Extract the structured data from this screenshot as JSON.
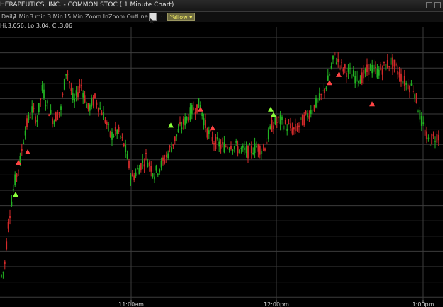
{
  "window": {
    "title": "HERAPEUTICS, INC. - COMMON STOC ( 1 Minute Chart)"
  },
  "toolbar": {
    "items": [
      "Daily",
      "1 Min",
      "3 min",
      "3 Min",
      "15 Min",
      "Zoom In",
      "Zoom Out",
      "Line"
    ],
    "color_selected": "Yellow",
    "icon": "cursor-icon"
  },
  "readout": "Hi:3.056, Lo:3.04, Cl:3.06",
  "colors": {
    "background": "#000000",
    "grid": "#3c3c3c",
    "up": "#22b422",
    "down": "#d42a2a",
    "buy_marker": "#8cff3a",
    "sell_marker": "#ff4444"
  },
  "chart_data": {
    "type": "candlestick",
    "x_tick_labels": [
      "11:00am",
      "12:00pm",
      "1:00pm"
    ],
    "price_path_points": [
      [
        0,
        0.06
      ],
      [
        6,
        0.1
      ],
      [
        12,
        0.28
      ],
      [
        20,
        0.42
      ],
      [
        28,
        0.5
      ],
      [
        35,
        0.62
      ],
      [
        45,
        0.7
      ],
      [
        52,
        0.66
      ],
      [
        60,
        0.78
      ],
      [
        66,
        0.72
      ],
      [
        75,
        0.66
      ],
      [
        86,
        0.7
      ],
      [
        94,
        0.86
      ],
      [
        104,
        0.72
      ],
      [
        114,
        0.8
      ],
      [
        124,
        0.7
      ],
      [
        134,
        0.74
      ],
      [
        146,
        0.68
      ],
      [
        156,
        0.6
      ],
      [
        166,
        0.62
      ],
      [
        176,
        0.56
      ],
      [
        186,
        0.44
      ],
      [
        196,
        0.48
      ],
      [
        206,
        0.52
      ],
      [
        218,
        0.46
      ],
      [
        230,
        0.5
      ],
      [
        242,
        0.56
      ],
      [
        252,
        0.62
      ],
      [
        262,
        0.66
      ],
      [
        272,
        0.7
      ],
      [
        282,
        0.72
      ],
      [
        292,
        0.62
      ],
      [
        302,
        0.58
      ],
      [
        314,
        0.56
      ],
      [
        326,
        0.57
      ],
      [
        338,
        0.55
      ],
      [
        350,
        0.54
      ],
      [
        362,
        0.56
      ],
      [
        372,
        0.55
      ],
      [
        384,
        0.64
      ],
      [
        394,
        0.66
      ],
      [
        404,
        0.64
      ],
      [
        416,
        0.62
      ],
      [
        428,
        0.66
      ],
      [
        440,
        0.7
      ],
      [
        452,
        0.74
      ],
      [
        462,
        0.8
      ],
      [
        472,
        0.9
      ],
      [
        482,
        0.86
      ],
      [
        492,
        0.84
      ],
      [
        502,
        0.82
      ],
      [
        512,
        0.82
      ],
      [
        522,
        0.86
      ],
      [
        532,
        0.84
      ],
      [
        542,
        0.86
      ],
      [
        552,
        0.88
      ],
      [
        562,
        0.84
      ],
      [
        572,
        0.8
      ],
      [
        584,
        0.78
      ],
      [
        594,
        0.66
      ],
      [
        604,
        0.58
      ],
      [
        616,
        0.6
      ]
    ],
    "buy_markers": [
      [
        22,
        0.38
      ],
      [
        241,
        0.64
      ],
      [
        382,
        0.7
      ],
      [
        386,
        0.68
      ]
    ],
    "sell_markers": [
      [
        26,
        0.5
      ],
      [
        39,
        0.54
      ],
      [
        283,
        0.7
      ],
      [
        300,
        0.63
      ],
      [
        465,
        0.8
      ],
      [
        478,
        0.83
      ],
      [
        525,
        0.72
      ]
    ]
  }
}
